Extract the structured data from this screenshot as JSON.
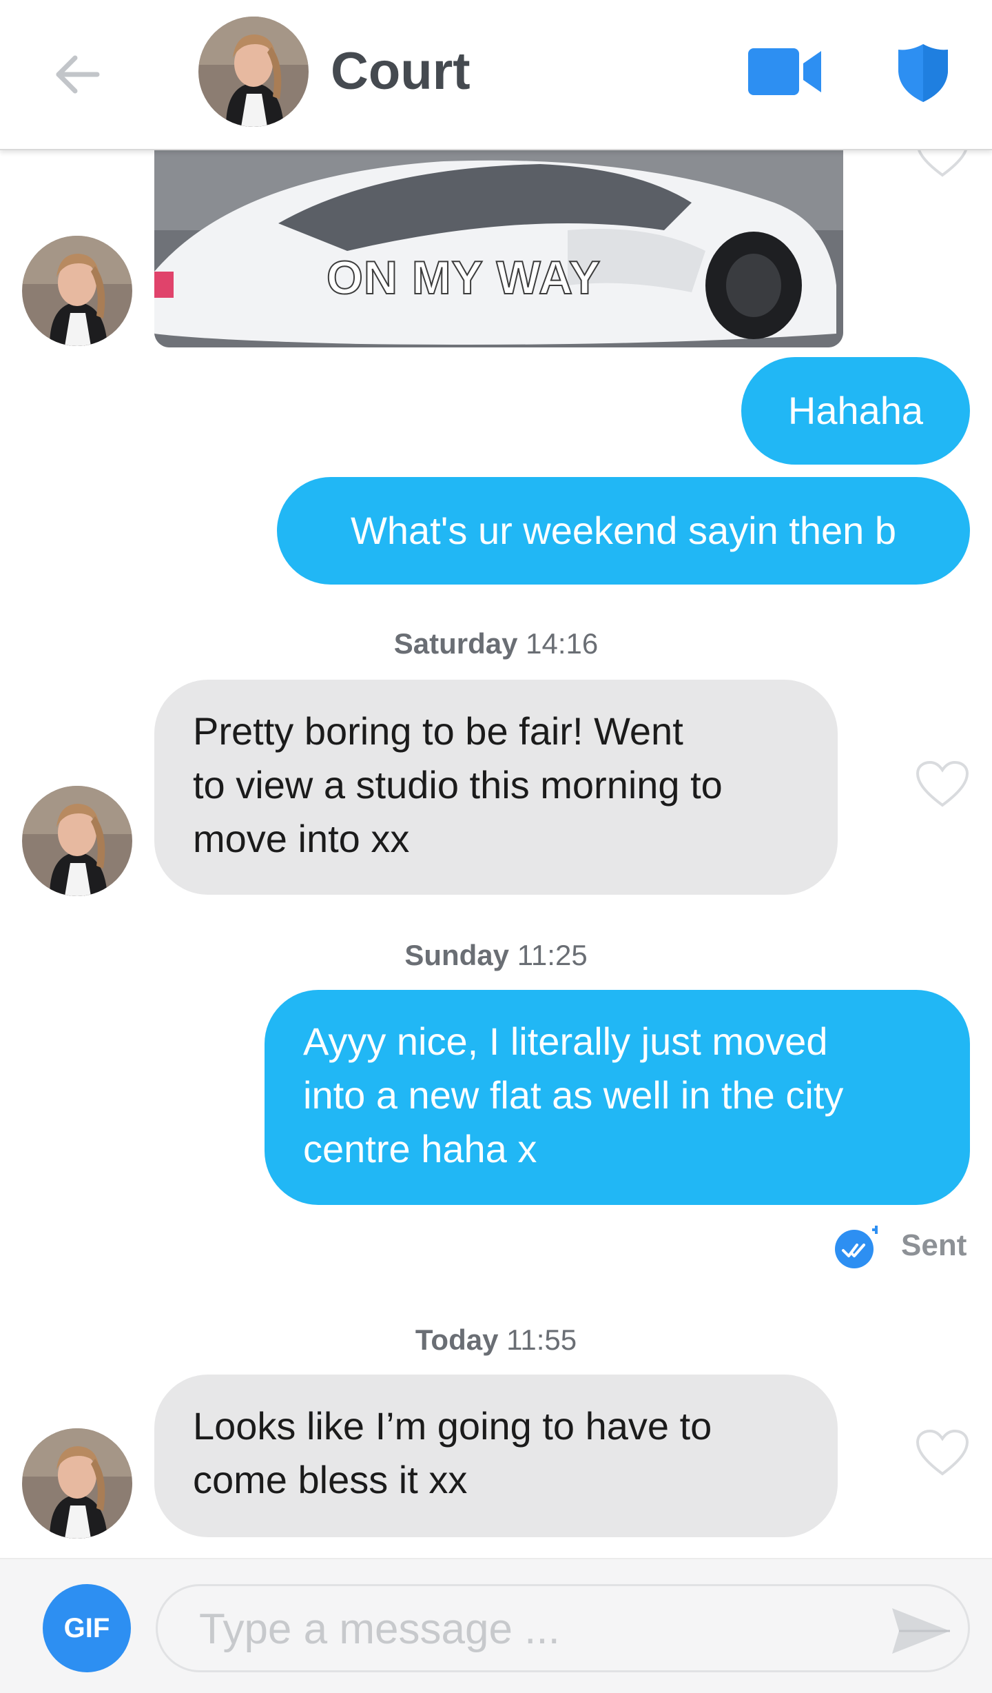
{
  "header": {
    "contact_name": "Court",
    "icons": {
      "back": "arrow-left-icon",
      "video": "video-camera-icon",
      "safety": "shield-icon"
    },
    "colors": {
      "accent_blue": "#2d8ff2",
      "name_text": "#454a50"
    }
  },
  "chat": {
    "gif_caption": "ON MY WAY",
    "messages": [
      {
        "direction": "outgoing",
        "text": "Hahaha"
      },
      {
        "direction": "outgoing",
        "text": "What's ur weekend sayin then b"
      },
      {
        "direction": "incoming",
        "lines": [
          "Pretty boring to be fair! Went",
          "to view a studio this morning to",
          "move into xx"
        ]
      },
      {
        "direction": "outgoing",
        "lines": [
          "Ayyy nice, I literally just moved",
          "into a new flat as well in the city",
          "centre haha x"
        ]
      },
      {
        "direction": "incoming",
        "lines": [
          "Looks like I’m going to have to",
          "come bless it xx"
        ]
      }
    ],
    "timestamps": [
      {
        "day": "Saturday",
        "time": "14:16"
      },
      {
        "day": "Sunday",
        "time": "11:25"
      },
      {
        "day": "Today",
        "time": "11:55"
      }
    ],
    "sent_status": "Sent",
    "colors": {
      "outgoing_bubble": "#21b7f5",
      "incoming_bubble": "#e7e7e8"
    }
  },
  "composer": {
    "gif_label": "GIF",
    "placeholder": "Type a message ...",
    "value": ""
  }
}
